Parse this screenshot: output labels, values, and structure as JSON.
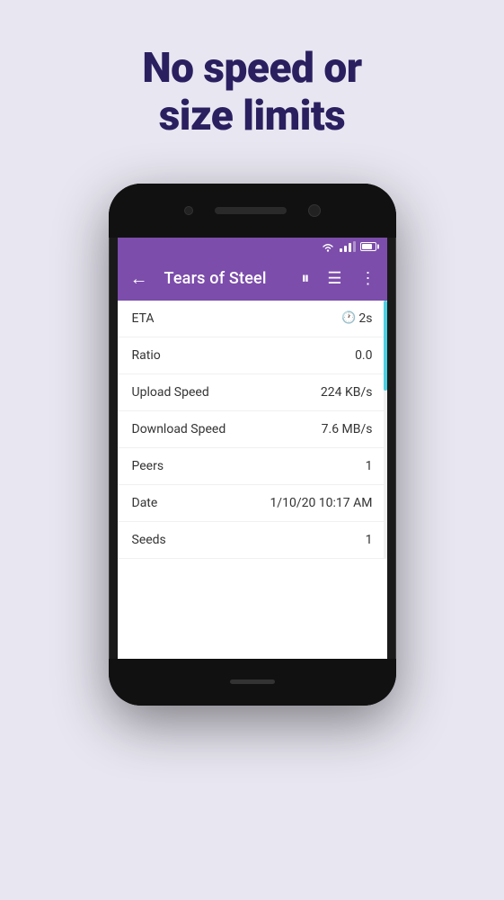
{
  "background_color": "#e8e6f0",
  "headline": {
    "line1": "No speed or",
    "line2": "size limits"
  },
  "phone": {
    "status_bar": {
      "bg_color": "#7c4dab"
    },
    "toolbar": {
      "bg_color": "#7c4dab",
      "title": "Tears of Steel",
      "back_label": "←",
      "pause_label": "⏸",
      "list_label": "☰",
      "more_label": "⋮"
    },
    "info_rows": [
      {
        "label": "ETA",
        "value": "2s",
        "has_clock": true
      },
      {
        "label": "Ratio",
        "value": "0.0",
        "has_clock": false
      },
      {
        "label": "Upload Speed",
        "value": "224 KB/s",
        "has_clock": false
      },
      {
        "label": "Download Speed",
        "value": "7.6 MB/s",
        "has_clock": false
      },
      {
        "label": "Peers",
        "value": "1",
        "has_clock": false
      },
      {
        "label": "Date",
        "value": "1/10/20 10:17 AM",
        "has_clock": false
      },
      {
        "label": "Seeds",
        "value": "1",
        "has_clock": false
      }
    ]
  }
}
